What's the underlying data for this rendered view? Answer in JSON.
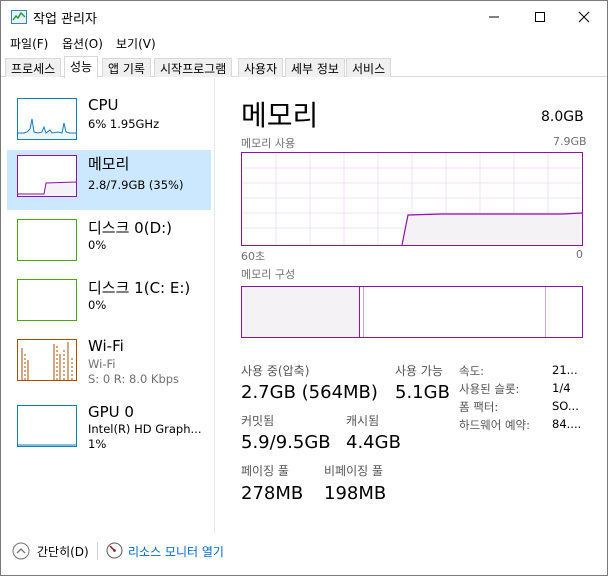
{
  "window": {
    "title": "작업 관리자",
    "icon": "task-manager-icon"
  },
  "menu": [
    "파일(F)",
    "옵션(O)",
    "보기(V)"
  ],
  "tabs": [
    "프로세스",
    "성능",
    "앱 기록",
    "시작프로그램",
    "사용자",
    "세부 정보",
    "서비스"
  ],
  "active_tab": "성능",
  "sidebar": {
    "items": [
      {
        "title": "CPU",
        "line1": "6% 1.95GHz",
        "line2": "",
        "color": "#117dbb"
      },
      {
        "title": "메모리",
        "line1": "2.8/7.9GB (35%)",
        "line2": "",
        "color": "#8b12ae",
        "selected": true
      },
      {
        "title": "디스크 0(D:)",
        "line1": "0%",
        "line2": "",
        "color": "#4da60c"
      },
      {
        "title": "디스크 1(C: E:)",
        "line1": "0%",
        "line2": "",
        "color": "#4da60c"
      },
      {
        "title": "Wi-Fi",
        "line1": "Wi-Fi",
        "line2": "S: 0 R: 8.0 Kbps",
        "color": "#a74f01"
      },
      {
        "title": "GPU 0",
        "line1": "Intel(R) HD Graph...",
        "line2": "1%",
        "color": "#117dbb"
      }
    ]
  },
  "main": {
    "title": "메모리",
    "total": "8.0GB",
    "usage_label": "메모리 사용",
    "usage_max": "7.9GB",
    "time_left": "60초",
    "time_right": "0",
    "usage_fraction": 0.35,
    "composition_label": "메모리 구성",
    "stats": {
      "in_use_label": "사용 중(압축)",
      "in_use_value": "2.7GB (564MB)",
      "available_label": "사용 가능",
      "available_value": "5.1GB",
      "committed_label": "커밋됨",
      "committed_value": "5.9/9.5GB",
      "cached_label": "캐시됨",
      "cached_value": "4.4GB",
      "paged_label": "페이징 풀",
      "paged_value": "278MB",
      "nonpaged_label": "비페이징 풀",
      "nonpaged_value": "198MB"
    },
    "details": [
      {
        "label": "속도:",
        "value": "21..."
      },
      {
        "label": "사용된 슬롯:",
        "value": "1/4"
      },
      {
        "label": "폼 팩터:",
        "value": "SO..."
      },
      {
        "label": "하드웨어 예약:",
        "value": "84...."
      }
    ]
  },
  "footer": {
    "collapse_label": "간단히(D)",
    "resource_monitor_label": "리소스 모니터 열기"
  },
  "colors": {
    "memory": "#8b12ae",
    "memory_fill": "#f4f2f4",
    "grid": "#f0e0f4",
    "selected_bg": "#cce8ff"
  }
}
